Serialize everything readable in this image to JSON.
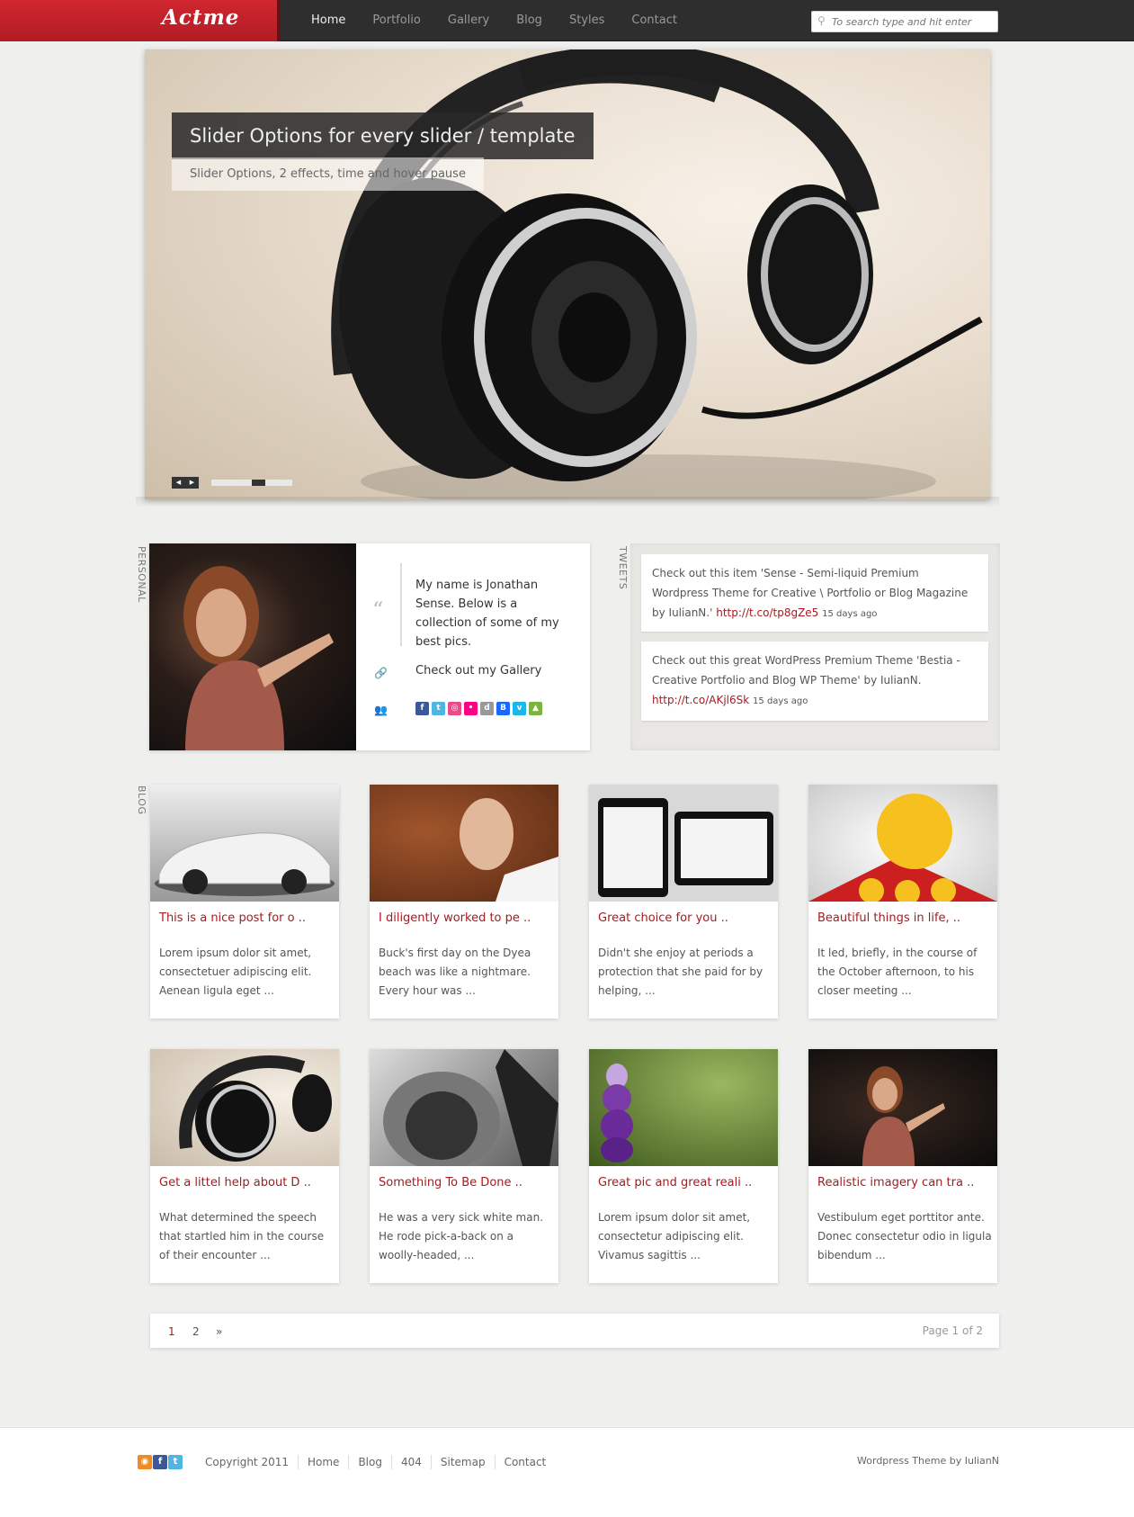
{
  "header": {
    "logo": "Actme",
    "nav": [
      "Home",
      "Portfolio",
      "Gallery",
      "Blog",
      "Styles",
      "Contact"
    ],
    "search_placeholder": "To search type and hit enter"
  },
  "slider": {
    "title": "Slider Options for every slider / template",
    "subtitle": "Slider Options, 2 effects, time and hover pause",
    "prev": "◀",
    "next": "▶"
  },
  "personal": {
    "label": "PERSONAL",
    "bio": "My name is Jonathan Sense. Below is a collection of some of my best pics.",
    "gallery_link": "Check out my Gallery"
  },
  "tweets": {
    "label": "TWEETS",
    "items": [
      {
        "text": "Check out this item 'Sense - Semi-liquid Premium Wordpress Theme for Creative \\ Portfolio or Blog Magazine by IulianN.'",
        "link": "http://t.co/tp8gZe5",
        "ago": "15 days ago"
      },
      {
        "text": "Check out this great WordPress Premium Theme 'Bestia - Creative Portfolio and Blog WP Theme' by IulianN.",
        "link": "http://t.co/AKjl6Sk",
        "ago": "15 days ago"
      }
    ]
  },
  "blog": {
    "label": "BLOG",
    "posts": [
      {
        "title": "This is a nice post for o ..",
        "excerpt": "Lorem ipsum dolor sit amet, consectetuer adipiscing elit. Aenean ligula eget ..."
      },
      {
        "title": "I diligently worked to pe ..",
        "excerpt": "Buck's first day on the Dyea beach was like a nightmare. Every hour was ..."
      },
      {
        "title": "Great choice for you ..",
        "excerpt": "Didn't she enjoy at periods a protection that she paid for by helping, ..."
      },
      {
        "title": "Beautiful things in life, ..",
        "excerpt": "It led, briefly, in the course of the October afternoon, to his closer meeting ..."
      },
      {
        "title": "Get a littel help about D ..",
        "excerpt": "What determined the speech that startled him in the course of their encounter ..."
      },
      {
        "title": "Something To Be Done ..",
        "excerpt": "He was a very sick white man. He rode pick-a-back on a woolly-headed, ..."
      },
      {
        "title": "Great pic and great reali ..",
        "excerpt": "Lorem ipsum dolor sit amet, consectetur adipiscing elit. Vivamus sagittis ..."
      },
      {
        "title": "Realistic imagery can tra ..",
        "excerpt": "Vestibulum eget porttitor ante. Donec consectetur odio in ligula bibendum ..."
      }
    ]
  },
  "pagination": {
    "pages": [
      "1",
      "2",
      "»"
    ],
    "info": "Page 1 of 2"
  },
  "footer": {
    "links": [
      "Copyright  2011",
      "Home",
      "Blog",
      "404",
      "Sitemap",
      "Contact"
    ],
    "credit": "Wordpress Theme by IulianN"
  },
  "colors": {
    "brand_red": "#c2212a",
    "link_red": "#a51b1f",
    "topbar": "#2e2e2e"
  }
}
